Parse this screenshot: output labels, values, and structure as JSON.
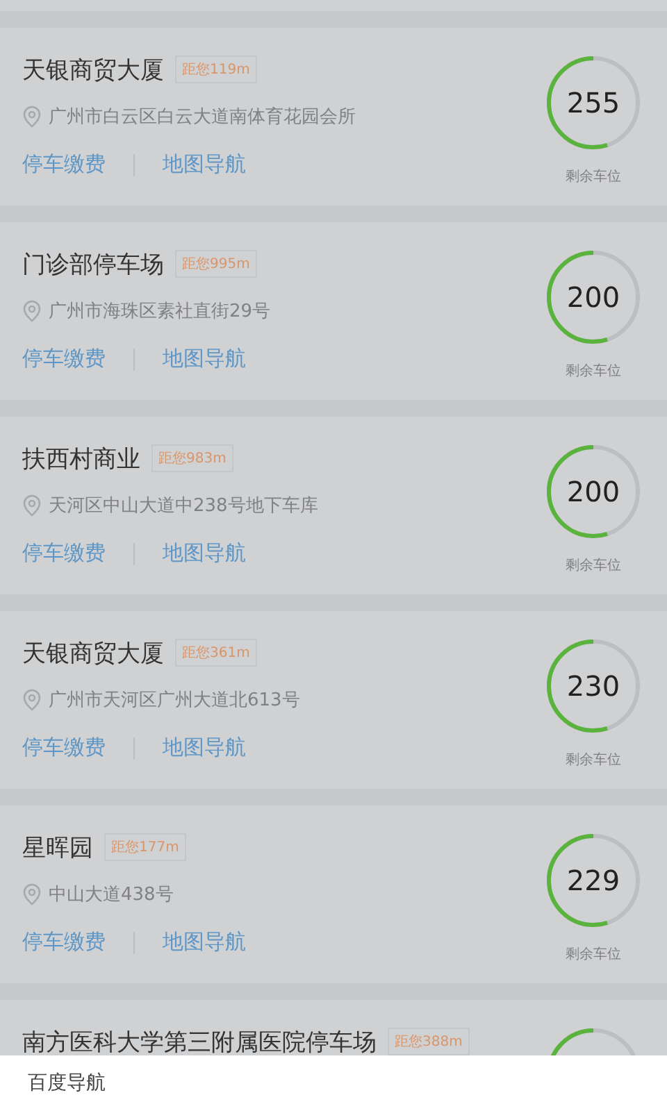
{
  "lots": [
    {
      "name": "天银商贸大厦",
      "distance": "距您119m",
      "address": "广州市白云区白云大道南体育花园会所",
      "actions": [
        "停车缴费",
        "地图导航"
      ],
      "spaces": "255",
      "spaces_label": "剩余车位"
    },
    {
      "name": "门诊部停车场",
      "distance": "距您995m",
      "address": "广州市海珠区素社直街29号",
      "actions": [
        "停车缴费",
        "地图导航"
      ],
      "spaces": "200",
      "spaces_label": "剩余车位"
    },
    {
      "name": "扶西村商业",
      "distance": "距您983m",
      "address": "天河区中山大道中238号地下车库",
      "actions": [
        "停车缴费",
        "地图导航"
      ],
      "spaces": "200",
      "spaces_label": "剩余车位"
    },
    {
      "name": "天银商贸大厦",
      "distance": "距您361m",
      "address": "广州市天河区广州大道北613号",
      "actions": [
        "停车缴费",
        "地图导航"
      ],
      "spaces": "230",
      "spaces_label": "剩余车位"
    },
    {
      "name": "星晖园",
      "distance": "距您177m",
      "address": "中山大道438号",
      "actions": [
        "停车缴费",
        "地图导航"
      ],
      "spaces": "229",
      "spaces_label": "剩余车位"
    },
    {
      "name": "南方医科大学第三附属医院停车场",
      "distance": "距您388m"
    }
  ],
  "sheet": {
    "options": [
      "百度导航"
    ]
  }
}
